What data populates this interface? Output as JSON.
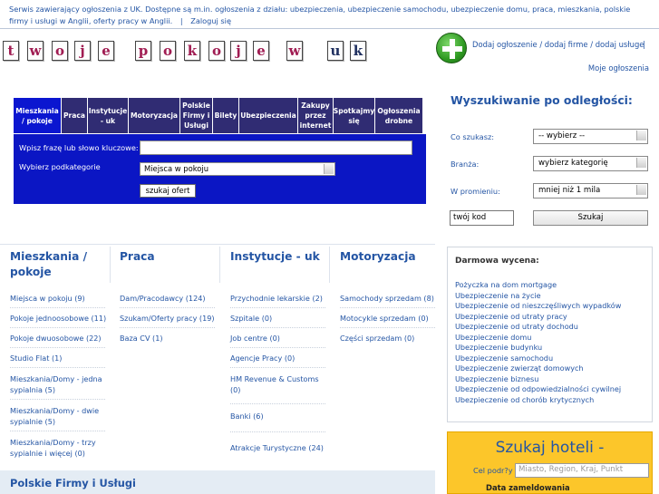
{
  "topbar": {
    "intro": "Serwis zawierający ogłoszenia z UK. Dostępne są m.in. ogłoszenia z działu: ubezpieczenia, ubezpieczenie samochodu, ubezpieczenie domu, praca, mieszkania, polskie firmy i usługi w Anglii, oferty pracy w Anglii.",
    "separator": "|",
    "login": "Zaloguj się"
  },
  "logo": {
    "letters": [
      "t",
      "w",
      "o",
      "j",
      "e",
      "p",
      "o",
      "k",
      "o",
      "j",
      "e",
      "w",
      "u",
      "k"
    ]
  },
  "header": {
    "add_link": "Dodaj ogłoszenie / dodaj firme / dodaj usługe",
    "add_separator": "|",
    "my_ads": "Moje ogłoszenia"
  },
  "catnav": [
    {
      "l1": "Mieszkania",
      "l2": "/ pokoje",
      "l3": ""
    },
    {
      "l1": "Praca",
      "l2": "",
      "l3": ""
    },
    {
      "l1": "Instytucje",
      "l2": "- uk",
      "l3": ""
    },
    {
      "l1": "Motoryzacja",
      "l2": "",
      "l3": ""
    },
    {
      "l1": "Polskie",
      "l2": "Firmy i",
      "l3": "Usługi"
    },
    {
      "l1": "Bilety",
      "l2": "",
      "l3": ""
    },
    {
      "l1": "Ubezpieczenia",
      "l2": "",
      "l3": ""
    },
    {
      "l1": "Zakupy",
      "l2": "przez",
      "l3": "internet"
    },
    {
      "l1": "Spotkajmy",
      "l2": "się",
      "l3": ""
    },
    {
      "l1": "Ogłoszenia",
      "l2": "drobne",
      "l3": ""
    }
  ],
  "search": {
    "keyword_label": "Wpisz frazę lub słowo kluczowe:",
    "keyword_value": "",
    "subcat_label": "Wybierz podkategorie",
    "subcat_value": "Miejsca w pokoju",
    "submit": "szukaj ofert"
  },
  "distance": {
    "title": "Wyszukiwanie po odległości:",
    "what_label": "Co szukasz:",
    "what_value": "-- wybierz --",
    "branch_label": "Branża:",
    "branch_value": "wybierz kategorię",
    "radius_label": "W promieniu:",
    "radius_value": "mniej niż 1 mila",
    "postcode_value": "twój kod",
    "submit": "Szukaj"
  },
  "columns": {
    "mieszkania": {
      "title_l1": "Mieszkania /",
      "title_l2": "pokoje",
      "items": [
        "Miejsca w pokoju (9)",
        "Pokoje jednoosobowe (11)",
        "Pokoje dwuosobowe (22)",
        "Studio Flat (1)",
        "Mieszkania/Domy - jedna",
        "sypialnia (5)",
        "Mieszkania/Domy - dwie",
        "sypialnie (5)",
        "Mieszkania/Domy - trzy",
        "sypialnie i więcej (0)"
      ]
    },
    "praca": {
      "title": "Praca",
      "items": [
        "Dam/Pracodawcy (124)",
        "Szukam/Oferty pracy (19)",
        "Baza CV (1)"
      ]
    },
    "instytucje": {
      "title": "Instytucje - uk",
      "items": [
        "Przychodnie lekarskie (2)",
        "Szpitale (0)",
        "Job centre (0)",
        "Agencje Pracy (0)",
        "HM Revenue & Customs",
        "(0)",
        "Banki (6)",
        "Atrakcje Turystyczne (24)"
      ]
    },
    "motoryzacja": {
      "title": "Motoryzacja",
      "items": [
        "Samochody sprzedam (8)",
        "Motocykle sprzedam (0)",
        "Części sprzedam (0)"
      ]
    }
  },
  "firms": {
    "title": "Polskie Firmy i Usługi"
  },
  "quote": {
    "title": "Darmowa wycena:",
    "items": [
      "Pożyczka na dom mortgage",
      "Ubezpieczenie na życie",
      "Ubezpieczenie od nieszczęśliwych wypadków",
      "Ubezpieczenie od utraty pracy",
      "Ubezpieczenie od utraty dochodu",
      "Ubezpieczenie domu",
      "Ubezpieczenie budynku",
      "Ubezpieczenie samochodu",
      "Ubezpieczenie zwierząt domowych",
      "Ubezpieczenie biznesu",
      "Ubezpieczenie od odpowiedzialności cywilnej",
      "Ubezpieczenie od chorób krytycznych"
    ]
  },
  "hotels": {
    "title": "Szukaj hoteli -",
    "where_label": "Cel podr?y",
    "where_placeholder": "Miasto, Region, Kraj, Punkt",
    "checkin_label": "Data zameldowania"
  },
  "colors": {
    "link": "#2455a4",
    "nav_bg": "#302c73",
    "nav_active": "#0b16d0",
    "search_bg": "#0b16c4",
    "hotel_bg": "#fcc62a",
    "logo_letter": "#a01c52"
  }
}
